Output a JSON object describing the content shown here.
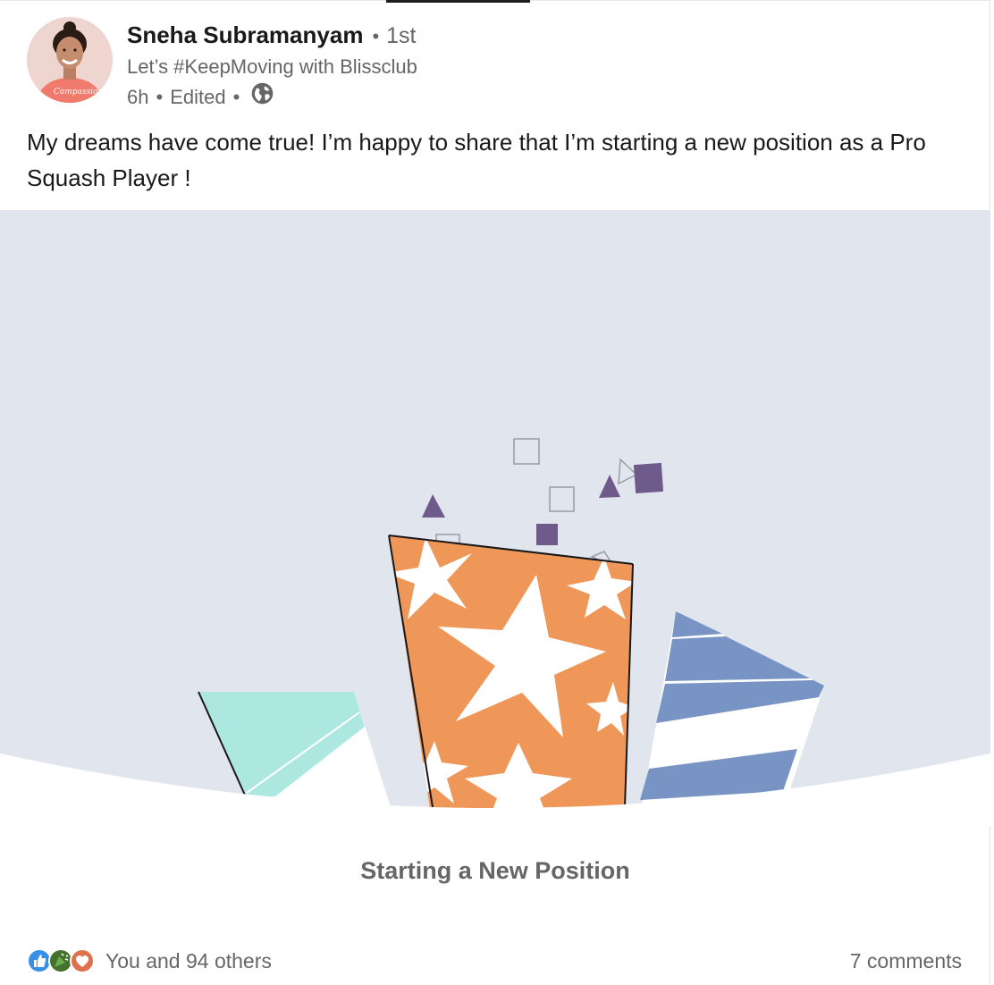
{
  "author": {
    "name": "Sneha Subramanyam",
    "separator": "•",
    "degree": "1st",
    "headline": "Let’s #KeepMoving with Blissclub",
    "time": "6h",
    "edited": "Edited",
    "visibility_icon": "globe-icon"
  },
  "post": {
    "text": "My dreams have come true! I’m happy to share that I’m starting a new position as a Pro Squash Player !"
  },
  "banner": {
    "caption": "Starting a New Position",
    "colors": {
      "background": "#e1e6ee",
      "orange": "#ef9758",
      "teal": "#ace8e0",
      "blue": "#7894c4",
      "purple": "#6f5a8c"
    }
  },
  "social": {
    "reaction_icons": [
      "like-icon",
      "celebrate-icon",
      "love-icon"
    ],
    "reactions_text": "You and 94 others",
    "comments_text": "7 comments"
  }
}
